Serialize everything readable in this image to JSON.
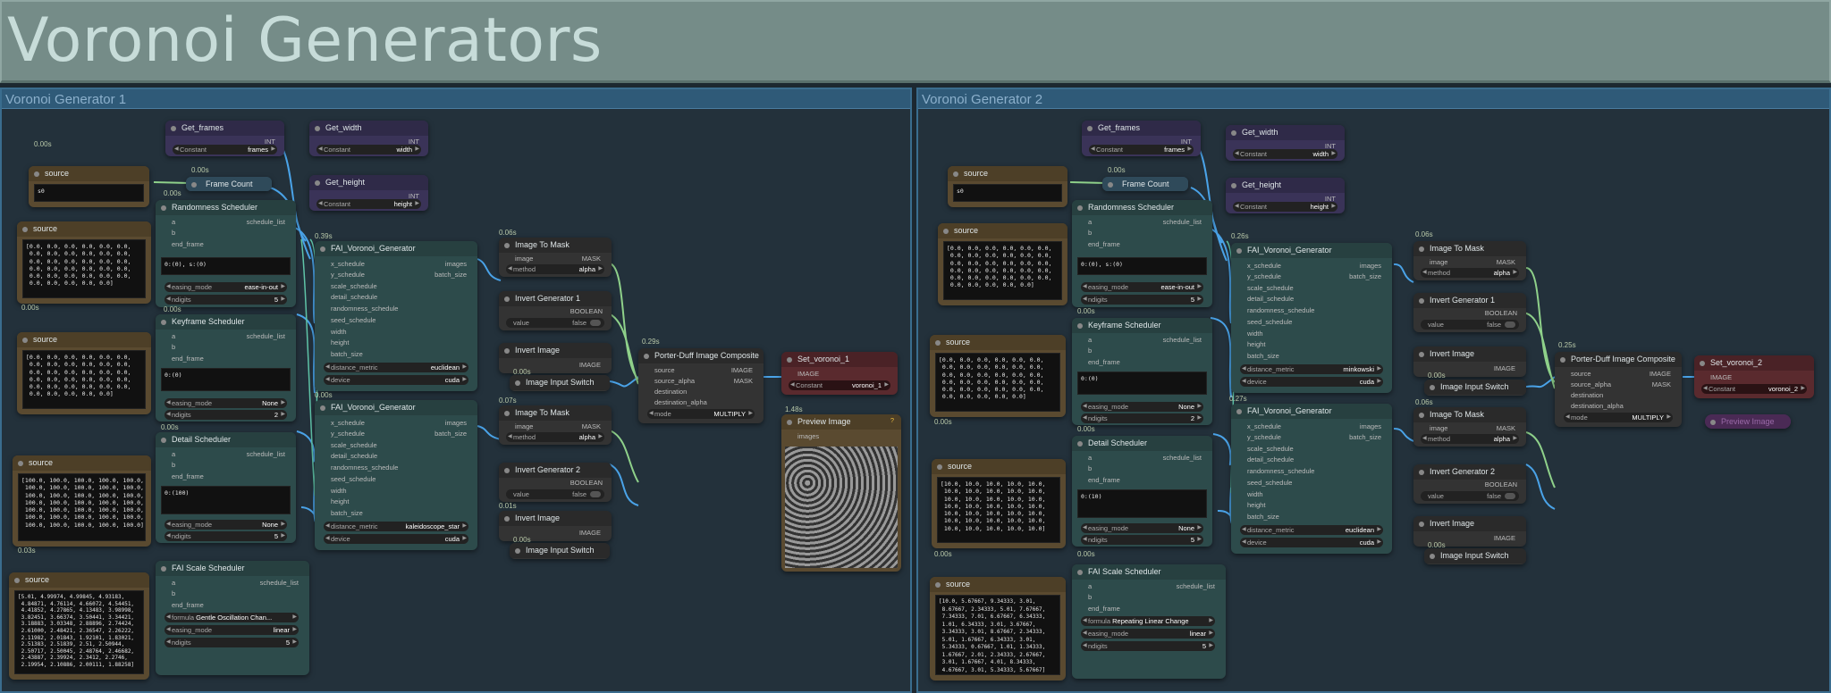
{
  "header": {
    "title": "Voronoi Generators"
  },
  "groups": [
    {
      "title": "Voronoi Generator 1"
    },
    {
      "title": "Voronoi Generator 2"
    }
  ],
  "common": {
    "get_frames": "Get_frames",
    "get_width": "Get_width",
    "get_height": "Get_height",
    "int": "INT",
    "constant": "Constant",
    "frames": "frames",
    "width": "width",
    "height": "height",
    "source": "source",
    "frame_count": "Frame Count",
    "randomness_scheduler": "Randomness Scheduler",
    "keyframe_scheduler": "Keyframe Scheduler",
    "detail_scheduler": "Detail Scheduler",
    "fai_scale_scheduler": "FAI Scale Scheduler",
    "a": "a",
    "b": "b",
    "end_frame": "end_frame",
    "schedule_list": "schedule_list",
    "easing_mode": "easing_mode",
    "ndigits": "ndigits",
    "formula": "formula",
    "voronoi": "FAI_Voronoi_Generator",
    "x_schedule": "x_schedule",
    "y_schedule": "y_schedule",
    "scale_schedule": "scale_schedule",
    "detail_schedule": "detail_schedule",
    "randomness_schedule": "randomness_schedule",
    "seed_schedule": "seed_schedule",
    "batch_size": "batch_size",
    "images": "images",
    "distance_metric": "distance_metric",
    "device": "device",
    "cuda": "cuda",
    "image_to_mask": "Image To Mask",
    "image": "image",
    "mask": "MASK",
    "method": "method",
    "alpha": "alpha",
    "invert_gen_1": "Invert Generator 1",
    "invert_gen_2": "Invert Generator 2",
    "boolean": "BOOLEAN",
    "value": "value",
    "false": "false",
    "invert_image": "Invert Image",
    "image_out": "IMAGE",
    "image_input_switch": "Image Input Switch",
    "porter": "Porter-Duff Image Composite",
    "source_alpha": "source_alpha",
    "destination": "destination",
    "destination_alpha": "destination_alpha",
    "mode": "mode",
    "multiply": "MULTIPLY",
    "preview": "Preview Image",
    "images_in": "images",
    "q": "?"
  },
  "g1": {
    "t_top": "0.00s",
    "t1": "0.00s",
    "t2": "0.00s",
    "t3": "0.00s",
    "t4": "0.00s",
    "t5": "0.03s",
    "t6": "0.00s",
    "t7": "0.39s",
    "t8": "0.06s",
    "t9": "0.00s",
    "t10": "0.07s",
    "t11": "0.01s",
    "t12": "0.00s",
    "t13": "0.29s",
    "t14": "1.48s",
    "t15": "0.00s",
    "t16": "0.00s",
    "src1": "s0",
    "src2": "[0.0, 0.0, 0.0, 0.0, 0.0, 0.0,\n 0.0, 0.0, 0.0, 0.0, 0.0, 0.0,\n 0.0, 0.0, 0.0, 0.0, 0.0, 0.0,\n 0.0, 0.0, 0.0, 0.0, 0.0, 0.0,\n 0.0, 0.0, 0.0, 0.0, 0.0, 0.0,\n 0.0, 0.0, 0.0, 0.0, 0.0]",
    "src3": "[0.0, 0.0, 0.0, 0.0, 0.0, 0.0,\n 0.0, 0.0, 0.0, 0.0, 0.0, 0.0,\n 0.0, 0.0, 0.0, 0.0, 0.0, 0.0,\n 0.0, 0.0, 0.0, 0.0, 0.0, 0.0,\n 0.0, 0.0, 0.0, 0.0, 0.0, 0.0,\n 0.0, 0.0, 0.0, 0.0, 0.0]",
    "src4": "[100.0, 100.0, 100.0, 100.0, 100.0,\n 100.0, 100.0, 100.0, 100.0, 100.0,\n 100.0, 100.0, 100.0, 100.0, 100.0,\n 100.0, 100.0, 100.0, 100.0, 100.0,\n 100.0, 100.0, 100.0, 100.0, 100.0,\n 100.0, 100.0, 100.0, 100.0, 100.0,\n 100.0, 100.0, 100.0, 100.0, 100.0]",
    "src5": "[5.01, 4.99974, 4.99845, 4.93183,\n 4.84871, 4.76114, 4.66072, 4.54451,\n 4.41852, 4.27865, 4.13483, 3.98998,\n 3.82451, 3.66374, 3.50441, 3.34421,\n 3.18883, 3.03348, 2.88896, 2.74424,\n 2.61000, 2.48421, 2.36547, 2.26222,\n 2.11982, 2.01843, 1.92101, 1.83021,\n 2.51383, 2.51839, 2.51, 2.50944,\n 2.50717, 2.50045, 2.48764, 2.46682,\n 2.43887, 2.39924, 2.3412, 2.2746,\n 2.19954, 2.10886, 2.00111, 1.88258]",
    "rand_expr": "0:(0), s:(0)",
    "key_expr": "0:(0)",
    "detail_expr": "0:(100)",
    "ease1": "ease-in-out",
    "nd1": "5",
    "ease2": "None",
    "nd2": "2",
    "ease3": "None",
    "nd3": "5",
    "ease4": "linear",
    "nd4": "5",
    "formula": "Gentle Oscillation Chan...",
    "dm1": "euclidean",
    "dm2": "kaleidoscope_star",
    "set": "Set_voronoi_1",
    "set_const": "voronoi_1"
  },
  "g2": {
    "t1": "0.00s",
    "t2": "0.00s",
    "t3": "0.00s",
    "t4": "0.00s",
    "t5": "0.00s",
    "t6": "0.00s",
    "t7": "0.26s",
    "t8": "0.06s",
    "t9": "0.00s",
    "t10": "0.06s",
    "t11": "0.27s",
    "t12": "0.00s",
    "t13": "0.25s",
    "t15": "0.00s",
    "src1": "s0",
    "src2": "[0.0, 0.0, 0.0, 0.0, 0.0, 0.0,\n 0.0, 0.0, 0.0, 0.0, 0.0, 0.0,\n 0.0, 0.0, 0.0, 0.0, 0.0, 0.0,\n 0.0, 0.0, 0.0, 0.0, 0.0, 0.0,\n 0.0, 0.0, 0.0, 0.0, 0.0, 0.0,\n 0.0, 0.0, 0.0, 0.0, 0.0]",
    "src3": "[0.0, 0.0, 0.0, 0.0, 0.0, 0.0,\n 0.0, 0.0, 0.0, 0.0, 0.0, 0.0,\n 0.0, 0.0, 0.0, 0.0, 0.0, 0.0,\n 0.0, 0.0, 0.0, 0.0, 0.0, 0.0,\n 0.0, 0.0, 0.0, 0.0, 0.0, 0.0,\n 0.0, 0.0, 0.0, 0.0, 0.0]",
    "src4": "[10.0, 10.0, 10.0, 10.0, 10.0,\n 10.0, 10.0, 10.0, 10.0, 10.0,\n 10.0, 10.0, 10.0, 10.0, 10.0,\n 10.0, 10.0, 10.0, 10.0, 10.0,\n 10.0, 10.0, 10.0, 10.0, 10.0,\n 10.0, 10.0, 10.0, 10.0, 10.0,\n 10.0, 10.0, 10.0, 10.0, 10.0]",
    "src5": "[10.0, 5.67667, 9.34333, 3.01,\n 8.67667, 2.34333, 5.01, 7.67667,\n 7.34333, 7.01, 6.67667, 6.34333,\n 1.01, 6.34333, 3.01, 3.67667,\n 3.34333, 3.01, 8.67667, 2.34333,\n 5.01, 1.67667, 6.34333, 3.01,\n 5.34333, 0.67667, 1.01, 1.34333,\n 1.67667, 2.01, 2.34333, 2.67667,\n 3.01, 1.67667, 4.01, 8.34333,\n 4.67667, 3.01, 5.34333, 5.67667]",
    "rand_expr": "0:(0), s:(0)",
    "key_expr": "0:(0)",
    "detail_expr": "0:(10)",
    "ease1": "ease-in-out",
    "nd1": "5",
    "ease2": "None",
    "nd2": "2",
    "ease3": "None",
    "nd3": "5",
    "ease4": "linear",
    "nd4": "5",
    "formula": "Repeating Linear Change",
    "dm1": "minkowski",
    "dm2": "euclidean",
    "set": "Set_voronoi_2",
    "set_const": "voronoi_2",
    "preview_collapsed": "Preview Image"
  },
  "colors": {
    "wire_blue": "#4aa3e8",
    "wire_green": "#8fd18a",
    "wire_teal": "#5fc4a8"
  }
}
